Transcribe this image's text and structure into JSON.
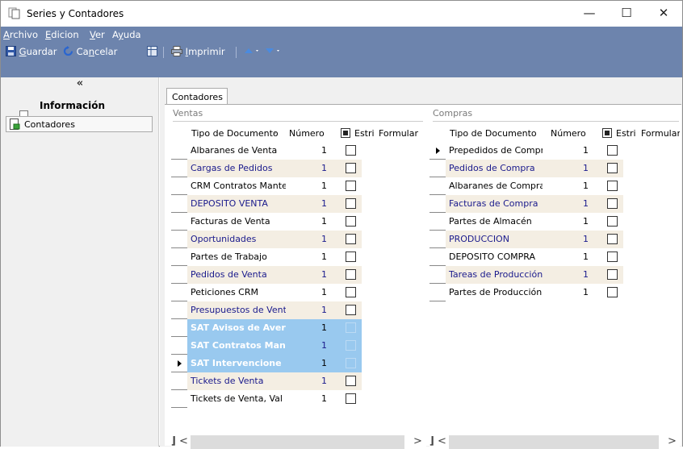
{
  "window": {
    "title": "Series y Contadores",
    "minimize": "—",
    "maximize": "☐",
    "close": "✕"
  },
  "menu": {
    "items": [
      {
        "pre": "",
        "u": "A",
        "post": "rchivo"
      },
      {
        "pre": "",
        "u": "E",
        "post": "dicion"
      },
      {
        "pre": "",
        "u": "V",
        "post": "er"
      },
      {
        "pre": "A",
        "u": "y",
        "post": "uda"
      }
    ]
  },
  "toolbar": {
    "save": {
      "pre": "",
      "u": "G",
      "post": "uardar"
    },
    "cancel": {
      "pre": "Ca",
      "u": "n",
      "post": "celar"
    },
    "print": {
      "pre": "",
      "u": "I",
      "post": "mprimir"
    }
  },
  "nav": {
    "collapse": "«",
    "group": "Información",
    "item": "Contadores"
  },
  "tab": {
    "label": "Contadores"
  },
  "ventas": {
    "label": "Ventas",
    "headers": {
      "tipo": "Tipo de Documento",
      "sort": "⁄",
      "numero": "Número",
      "estri": "Estri",
      "formular": "Formular"
    },
    "rows": [
      {
        "name": "Albaranes de Venta",
        "num": "1"
      },
      {
        "name": "Cargas de Pedidos",
        "num": "1"
      },
      {
        "name": "CRM Contratos Mante",
        "num": "1"
      },
      {
        "name": "DEPOSITO VENTA",
        "num": "1"
      },
      {
        "name": "Facturas de Venta",
        "num": "1"
      },
      {
        "name": "Oportunidades",
        "num": "1"
      },
      {
        "name": "Partes de Trabajo",
        "num": "1"
      },
      {
        "name": "Pedidos de Venta",
        "num": "1"
      },
      {
        "name": "Peticiones CRM",
        "num": "1"
      },
      {
        "name": "Presupuestos de Vent",
        "num": "1"
      },
      {
        "name": "SAT Avisos de Aver",
        "num": "1"
      },
      {
        "name": "SAT Contratos Man",
        "num": "1"
      },
      {
        "name": "SAT Intervencione",
        "num": "1"
      },
      {
        "name": "Tickets de Venta",
        "num": "1"
      },
      {
        "name": "Tickets de Venta, Val",
        "num": "1"
      }
    ]
  },
  "compras": {
    "label": "Compras",
    "headers": {
      "tipo": "Tipo de Documento",
      "numero": "Número",
      "estri": "Estri",
      "formular": "Formular"
    },
    "rows": [
      {
        "name": "Prepedidos de Compr",
        "num": "1"
      },
      {
        "name": "Pedidos de Compra",
        "num": "1"
      },
      {
        "name": "Albaranes de Compra",
        "num": "1"
      },
      {
        "name": "Facturas de Compra",
        "num": "1"
      },
      {
        "name": "Partes de Almacén",
        "num": "1"
      },
      {
        "name": "PRODUCCION",
        "num": "1"
      },
      {
        "name": "DEPOSITO COMPRA",
        "num": "1"
      },
      {
        "name": "Tareas de Producción",
        "num": "1"
      },
      {
        "name": "Partes de Producción",
        "num": "1"
      }
    ]
  },
  "scroll": {
    "left": "<",
    "right": ">"
  }
}
